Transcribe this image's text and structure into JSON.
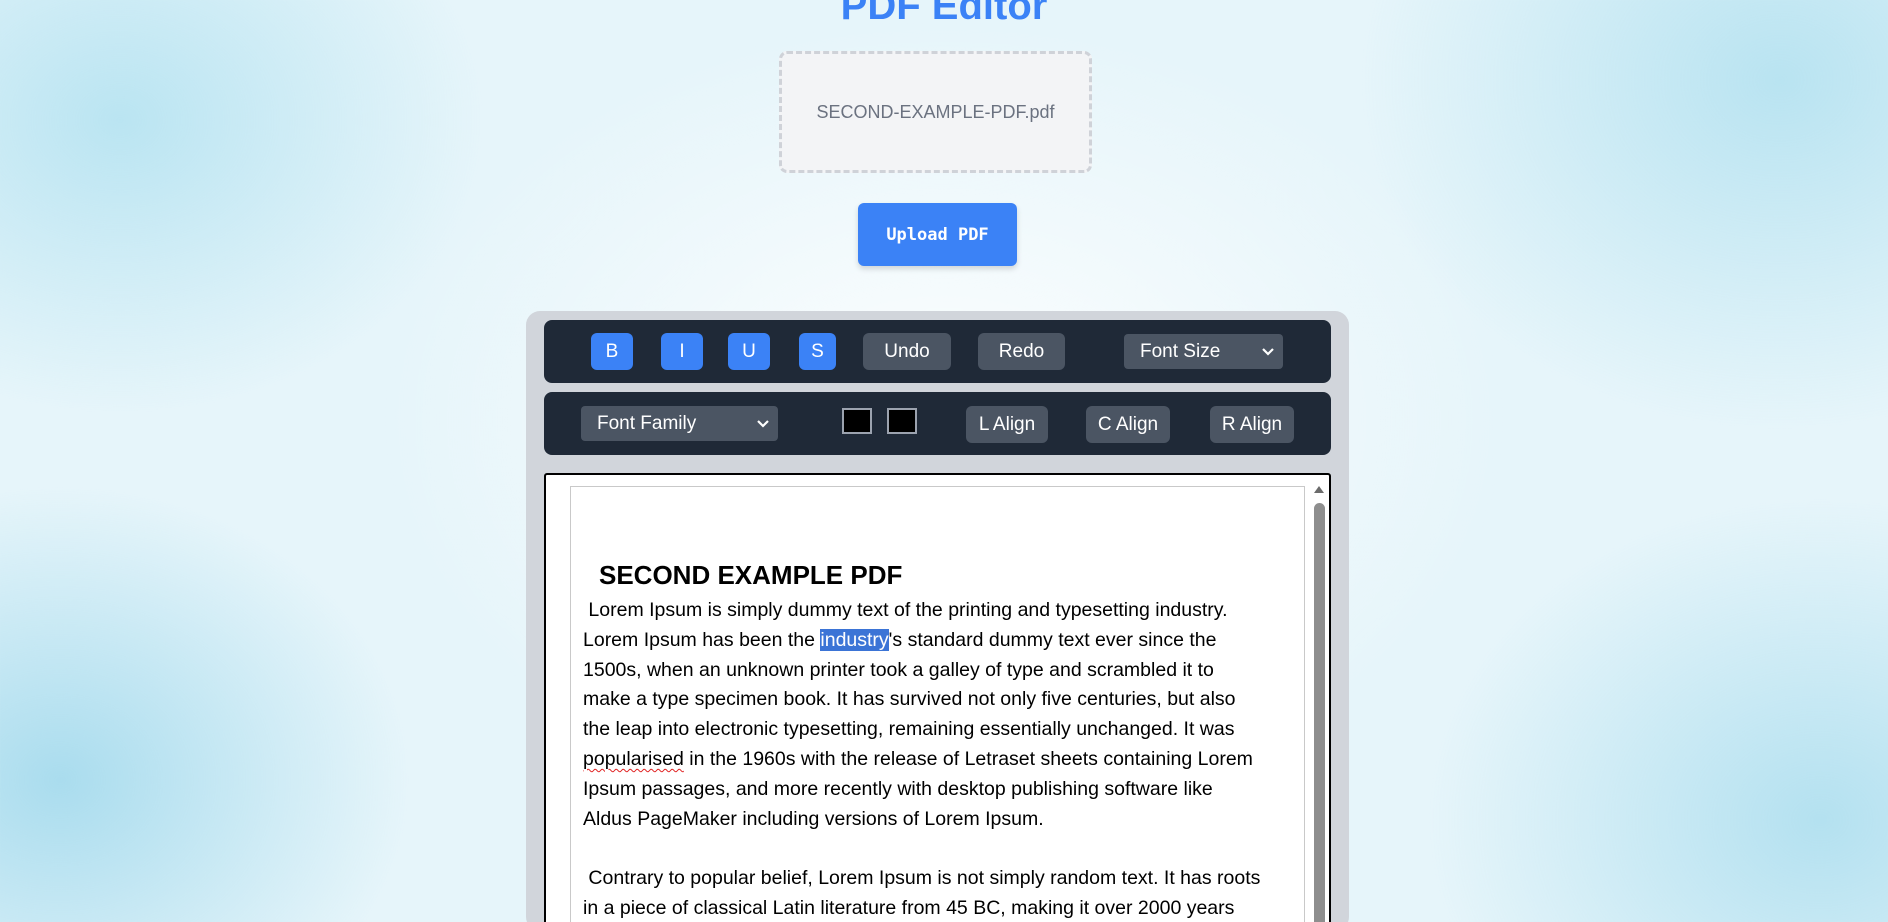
{
  "app": {
    "title": "PDF Editor"
  },
  "upload": {
    "filename": "SECOND-EXAMPLE-PDF.pdf",
    "button_label": "Upload PDF"
  },
  "toolbar_row1": {
    "bold": "B",
    "italic": "I",
    "underline": "U",
    "strike": "S",
    "undo": "Undo",
    "redo": "Redo",
    "font_size": "Font Size"
  },
  "toolbar_row2": {
    "font_family": "Font Family",
    "text_color": "#000000",
    "bg_color": "#000000",
    "left_align": "L Align",
    "center_align": "C Align",
    "right_align": "R Align"
  },
  "document": {
    "heading": "SECOND EXAMPLE PDF",
    "para1_lines": [
      " Lorem Ipsum is simply dummy text of the printing and typesetting industry.",
      "Lorem Ipsum has been the ",
      "industry",
      "'s standard dummy text ever since the",
      "1500s, when an unknown printer took a galley of type and scrambled it to",
      "make a type specimen book. It has survived not only five centuries, but also",
      "the leap into electronic typesetting, remaining essentially unchanged. It was",
      "popularised",
      " in the 1960s with the release of Letraset sheets containing Lorem",
      "Ipsum passages, and more recently with desktop publishing software like",
      "Aldus PageMaker including versions of Lorem Ipsum."
    ],
    "para2_lines": [
      " Contrary to popular belief, Lorem Ipsum is not simply random text. It has roots",
      "in a piece of classical Latin literature from 45 BC, making it over 2000 years"
    ]
  },
  "colors": {
    "accent": "#3b82f6",
    "toolbar_bg": "#1f2937",
    "toolbar_button": "#4b5563",
    "selection": "#3b74d6"
  },
  "icons": {
    "font_size_select": "chevron-down-icon",
    "font_family_select": "chevron-down-icon",
    "scroll_up": "triangle-up-icon"
  }
}
